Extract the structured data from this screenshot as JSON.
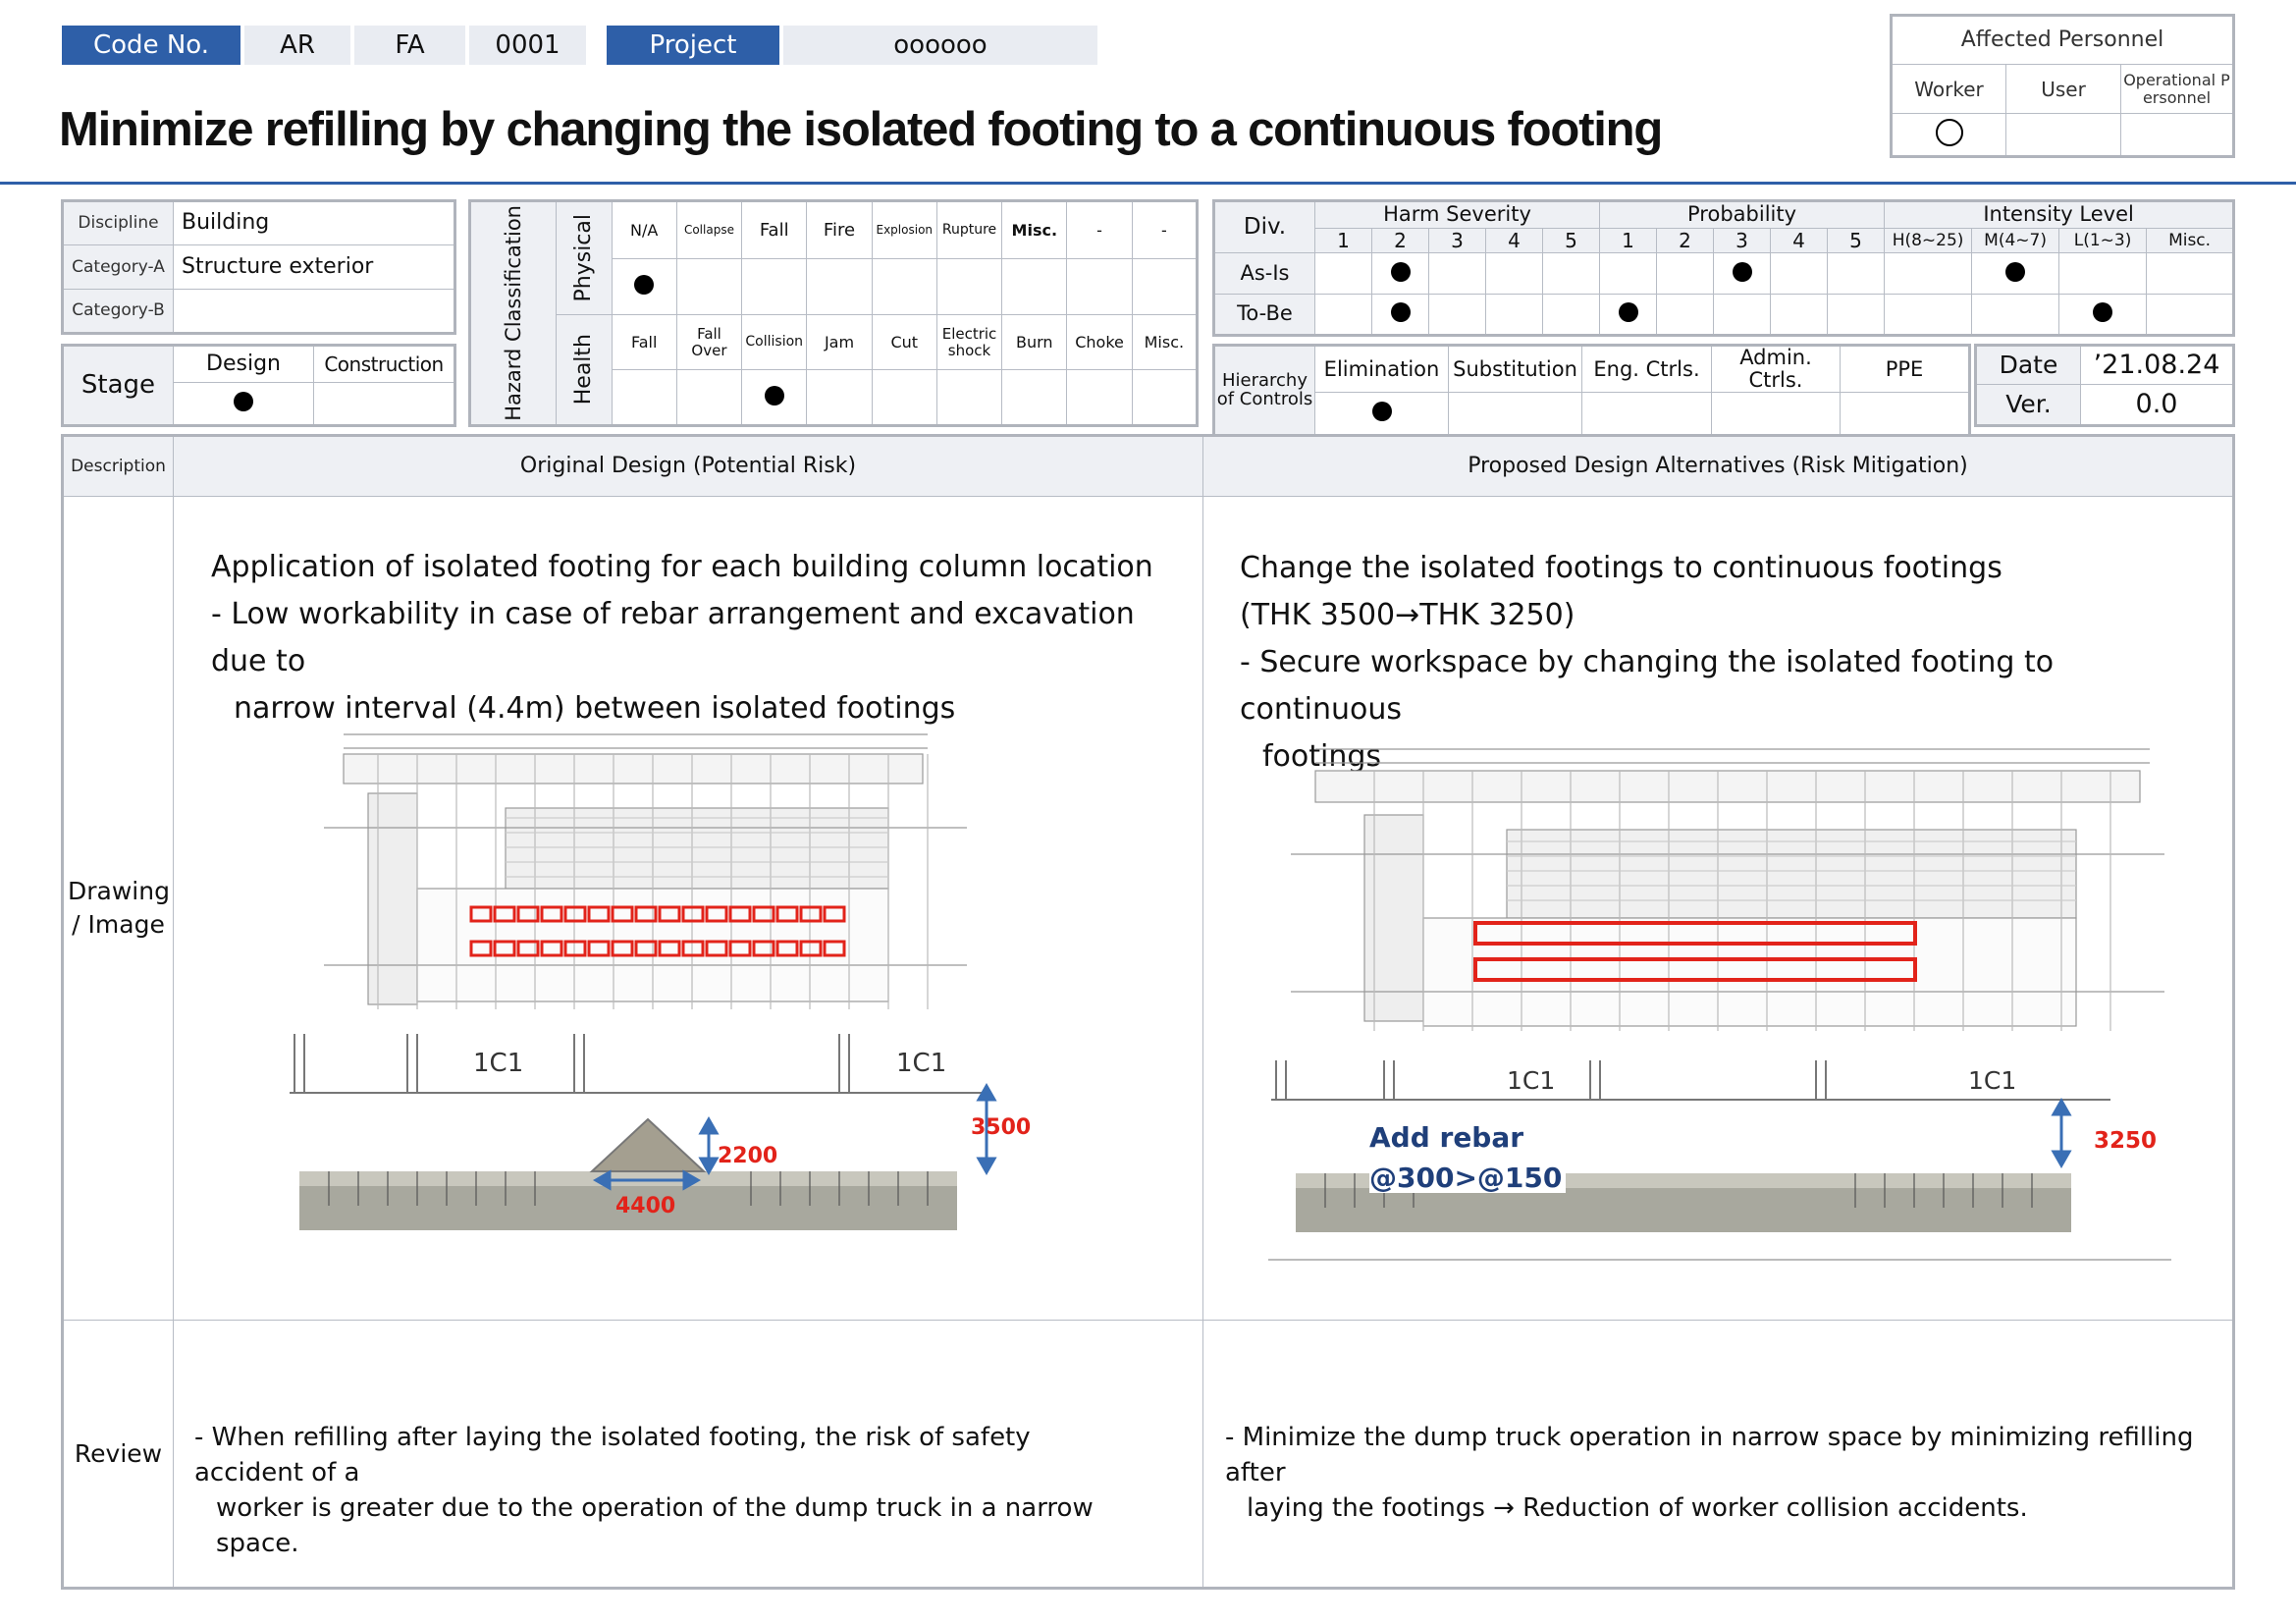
{
  "header": {
    "code_no_label": "Code No.",
    "code_parts": [
      "AR",
      "FA",
      "0001"
    ],
    "project_label": "Project",
    "project_value": "oooooo",
    "title": "Minimize refilling by changing the isolated footing to a continuous footing"
  },
  "affected_personnel": {
    "title": "Affected Personnel",
    "columns": [
      "Worker",
      "User",
      "Operational P ersonnel"
    ],
    "marks": [
      "ring",
      "",
      ""
    ]
  },
  "discipline": {
    "rows": [
      {
        "label": "Discipline",
        "value": "Building"
      },
      {
        "label": "Category-A",
        "value": "Structure exterior"
      },
      {
        "label": "Category-B",
        "value": ""
      }
    ]
  },
  "stage": {
    "label": "Stage",
    "columns": [
      "Design",
      "Construction"
    ],
    "marks": [
      "dot",
      ""
    ]
  },
  "hazard": {
    "title": "Hazard Classification",
    "physical_label": "Physical",
    "physical_items": [
      "N/A",
      "Collapse",
      "Fall",
      "Fire",
      "Explosion",
      "Rupture",
      "Misc.",
      "-",
      "-"
    ],
    "physical_marks": [
      "dot",
      "",
      "",
      "",
      "",
      "",
      "",
      "",
      ""
    ],
    "health_label": "Health",
    "health_items": [
      "Fall",
      "Fall Over",
      "Collision",
      "Jam",
      "Cut",
      "Electric shock",
      "Burn",
      "Choke",
      "Misc."
    ],
    "health_marks": [
      "",
      "",
      "dot",
      "",
      "",
      "",
      "",
      "",
      ""
    ]
  },
  "risk": {
    "div_label": "Div.",
    "harm_severity": "Harm Severity",
    "probability": "Probability",
    "intensity_level": "Intensity Level",
    "scale": [
      "1",
      "2",
      "3",
      "4",
      "5"
    ],
    "intensity_cols": [
      "H(8~25)",
      "M(4~7)",
      "L(1~3)",
      "Misc."
    ],
    "rows": [
      {
        "label": "As-Is",
        "severity": 2,
        "probability": 3,
        "intensity": "M(4~7)"
      },
      {
        "label": "To-Be",
        "severity": 2,
        "probability": 1,
        "intensity": "L(1~3)"
      }
    ]
  },
  "hierarchy": {
    "label": "Hierarchy of Controls",
    "columns": [
      "Elimination",
      "Substitution",
      "Eng. Ctrls.",
      "Admin. Ctrls.",
      "PPE"
    ],
    "marks": [
      "dot",
      "",
      "",
      "",
      ""
    ]
  },
  "meta": {
    "date_label": "Date",
    "date_value": "’21.08.24",
    "ver_label": "Ver.",
    "ver_value": "0.0"
  },
  "main": {
    "description_label": "Description",
    "original_header": "Original Design (Potential Risk)",
    "proposed_header": "Proposed Design Alternatives (Risk Mitigation)",
    "drawing_label": "Drawing / Image",
    "review_label": "Review",
    "original_text": [
      "Application of isolated footing for each building column location",
      "- Low workability in case of rebar arrangement and excavation due to",
      "narrow interval (4.4m) between isolated footings"
    ],
    "proposed_text": [
      "Change the isolated footings to continuous footings",
      "(THK 3500→THK 3250)",
      "- Secure workspace by changing the isolated footing to continuous",
      "footings"
    ],
    "original_drawing": {
      "label_left": "1C1",
      "label_right": "1C1",
      "dim_width": "4400",
      "dim_height": "2200",
      "dim_depth": "3500"
    },
    "proposed_drawing": {
      "label_left": "1C1",
      "label_right": "1C1",
      "dim_depth": "3250",
      "note_line1": "Add rebar",
      "note_line2": "@300>@150"
    },
    "original_review": [
      "- When refilling after laying the isolated footing, the risk of safety accident of a",
      "worker is greater due to the operation of the dump truck in a narrow space."
    ],
    "proposed_review": [
      "- Minimize the dump truck operation in narrow space by minimizing refilling after",
      "laying the footings → Reduction of worker collision accidents."
    ]
  }
}
